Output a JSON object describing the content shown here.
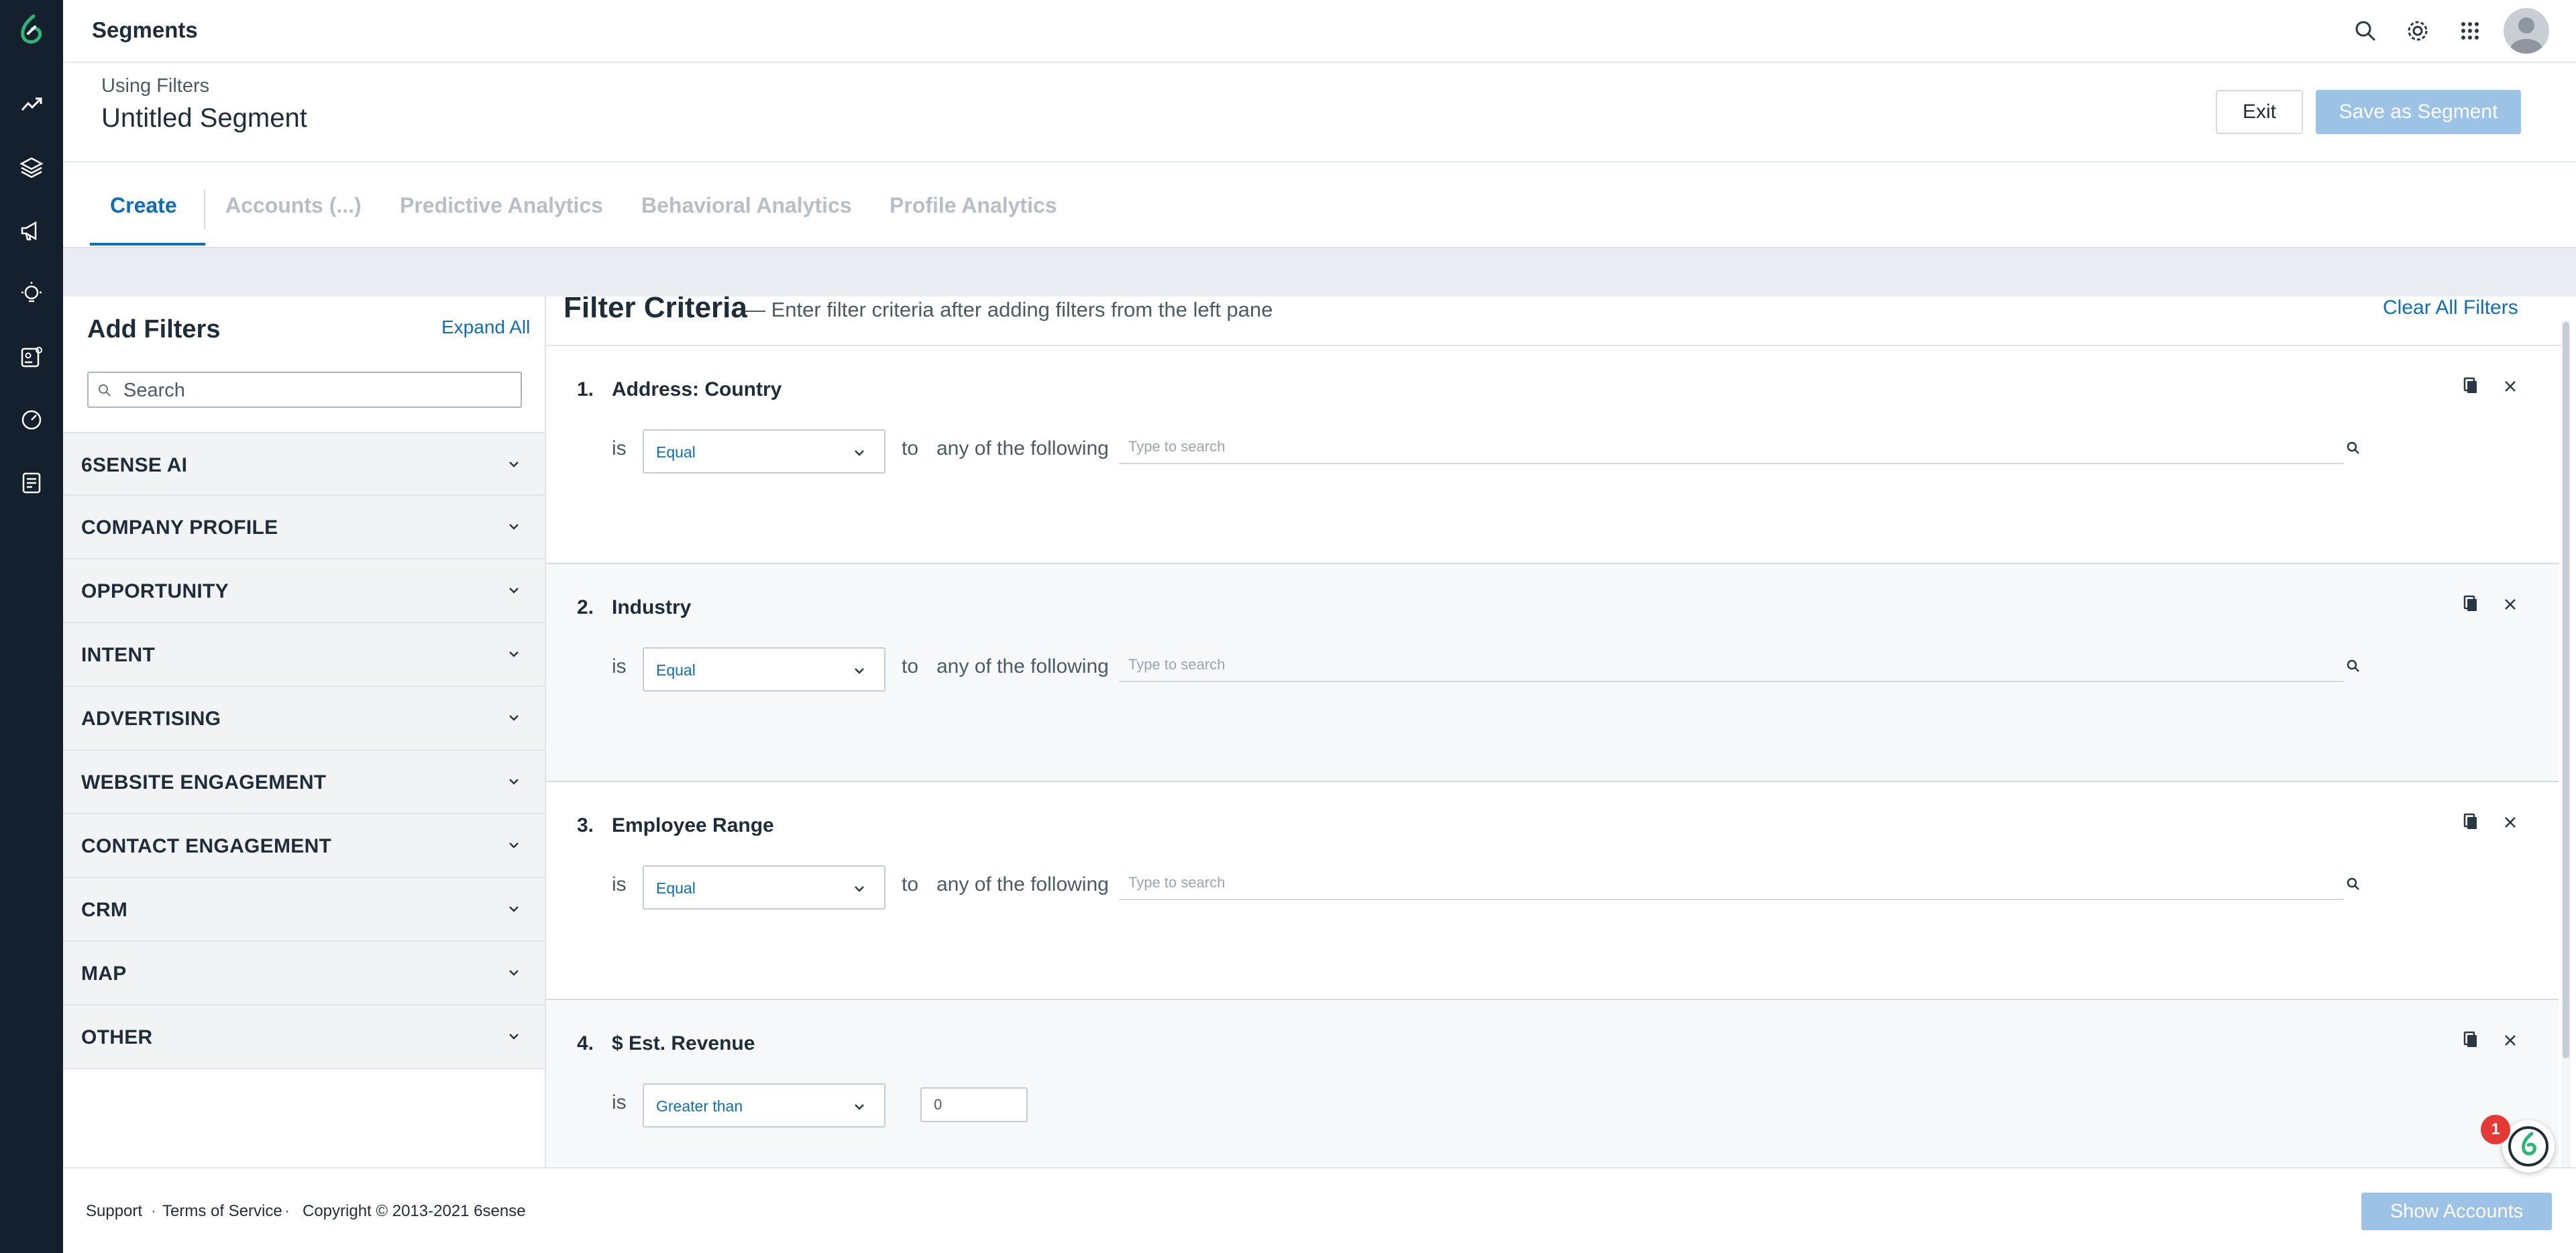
{
  "colors": {
    "rail_bg": "#14202e",
    "accent_blue": "#0d6fb8",
    "disabled_button": "#9cc3e6",
    "logo_green": "#2bb673",
    "badge_red": "#e53935"
  },
  "rail": {
    "icons": [
      "sixsense-logo-icon",
      "trend-icon",
      "layers-icon",
      "megaphone-icon",
      "lightbulb-icon",
      "contact-card-icon",
      "gauge-icon",
      "report-icon"
    ]
  },
  "topbar": {
    "title": "Segments",
    "icons": [
      "search-icon",
      "gear-icon",
      "apps-grid-icon",
      "avatar"
    ]
  },
  "header": {
    "using_label": "Using Filters",
    "segment_name": "Untitled Segment",
    "exit_label": "Exit",
    "save_label": "Save as Segment"
  },
  "tabs": [
    {
      "label": "Create",
      "active": true
    },
    {
      "label": "Accounts (...)",
      "active": false
    },
    {
      "label": "Predictive Analytics",
      "active": false
    },
    {
      "label": "Behavioral Analytics",
      "active": false
    },
    {
      "label": "Profile Analytics",
      "active": false
    }
  ],
  "left_panel": {
    "title": "Add Filters",
    "expand_all": "Expand All",
    "search_placeholder": "Search",
    "categories": [
      "6SENSE AI",
      "COMPANY PROFILE",
      "OPPORTUNITY",
      "INTENT",
      "ADVERTISING",
      "WEBSITE ENGAGEMENT",
      "CONTACT ENGAGEMENT",
      "CRM",
      "MAP",
      "OTHER"
    ]
  },
  "criteria": {
    "title": "Filter Criteria",
    "subtitle": "— Enter filter criteria after adding filters from the left pane",
    "clear_all": "Clear All Filters",
    "filters": [
      {
        "num": "1.",
        "name": "Address: Country",
        "is": "is",
        "operator": "Equal",
        "to": "to",
        "any": "any of the following",
        "placeholder": "Type to search"
      },
      {
        "num": "2.",
        "name": "Industry",
        "is": "is",
        "operator": "Equal",
        "to": "to",
        "any": "any of the following",
        "placeholder": "Type to search"
      },
      {
        "num": "3.",
        "name": "Employee Range",
        "is": "is",
        "operator": "Equal",
        "to": "to",
        "any": "any of the following",
        "placeholder": "Type to search"
      },
      {
        "num": "4.",
        "name": "$ Est. Revenue",
        "is": "is",
        "operator": "Greater than",
        "value": "0"
      }
    ]
  },
  "footer": {
    "support": "Support",
    "terms": "Terms of Service",
    "copyright": "Copyright © 2013-2021 6sense",
    "separator": "·",
    "show_accounts": "Show Accounts"
  },
  "chat": {
    "badge": "1"
  }
}
